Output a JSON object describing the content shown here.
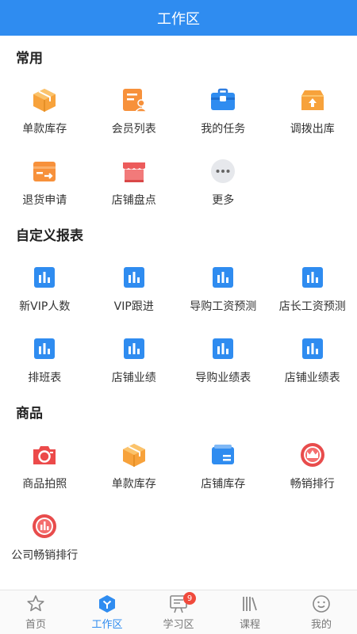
{
  "header": {
    "title": "工作区"
  },
  "sections": [
    {
      "title": "常用",
      "items": [
        {
          "label": "单款库存",
          "icon": "box-icon"
        },
        {
          "label": "会员列表",
          "icon": "member-list-icon"
        },
        {
          "label": "我的任务",
          "icon": "briefcase-icon"
        },
        {
          "label": "调拨出库",
          "icon": "transfer-out-icon"
        },
        {
          "label": "退货申请",
          "icon": "return-icon"
        },
        {
          "label": "店铺盘点",
          "icon": "store-icon"
        },
        {
          "label": "更多",
          "icon": "more-icon"
        }
      ]
    },
    {
      "title": "自定义报表",
      "items": [
        {
          "label": "新VIP人数",
          "icon": "report-chart-icon"
        },
        {
          "label": "VIP跟进",
          "icon": "report-chart-icon"
        },
        {
          "label": "导购工资预测",
          "icon": "report-chart-icon"
        },
        {
          "label": "店长工资预测",
          "icon": "report-chart-icon"
        },
        {
          "label": "排班表",
          "icon": "report-chart-icon"
        },
        {
          "label": "店铺业绩",
          "icon": "report-chart-icon"
        },
        {
          "label": "导购业绩表",
          "icon": "report-chart-icon"
        },
        {
          "label": "店铺业绩表",
          "icon": "report-chart-icon"
        }
      ]
    },
    {
      "title": "商品",
      "items": [
        {
          "label": "商品拍照",
          "icon": "camera-icon"
        },
        {
          "label": "单款库存",
          "icon": "box-icon"
        },
        {
          "label": "店铺库存",
          "icon": "wallet-icon"
        },
        {
          "label": "畅销排行",
          "icon": "crown-icon"
        },
        {
          "label": "公司畅销排行",
          "icon": "rank-chart-icon"
        }
      ]
    }
  ],
  "tabbar": [
    {
      "label": "首页",
      "icon": "star-icon",
      "active": false
    },
    {
      "label": "工作区",
      "icon": "workspace-icon",
      "active": true
    },
    {
      "label": "学习区",
      "icon": "study-icon",
      "active": false,
      "badge": "9"
    },
    {
      "label": "课程",
      "icon": "books-icon",
      "active": false
    },
    {
      "label": "我的",
      "icon": "smile-icon",
      "active": false
    }
  ],
  "colors": {
    "primary": "#2f8cf0",
    "orange": "#f7a23b",
    "red": "#e84c4c",
    "badge": "#f04a3c"
  }
}
